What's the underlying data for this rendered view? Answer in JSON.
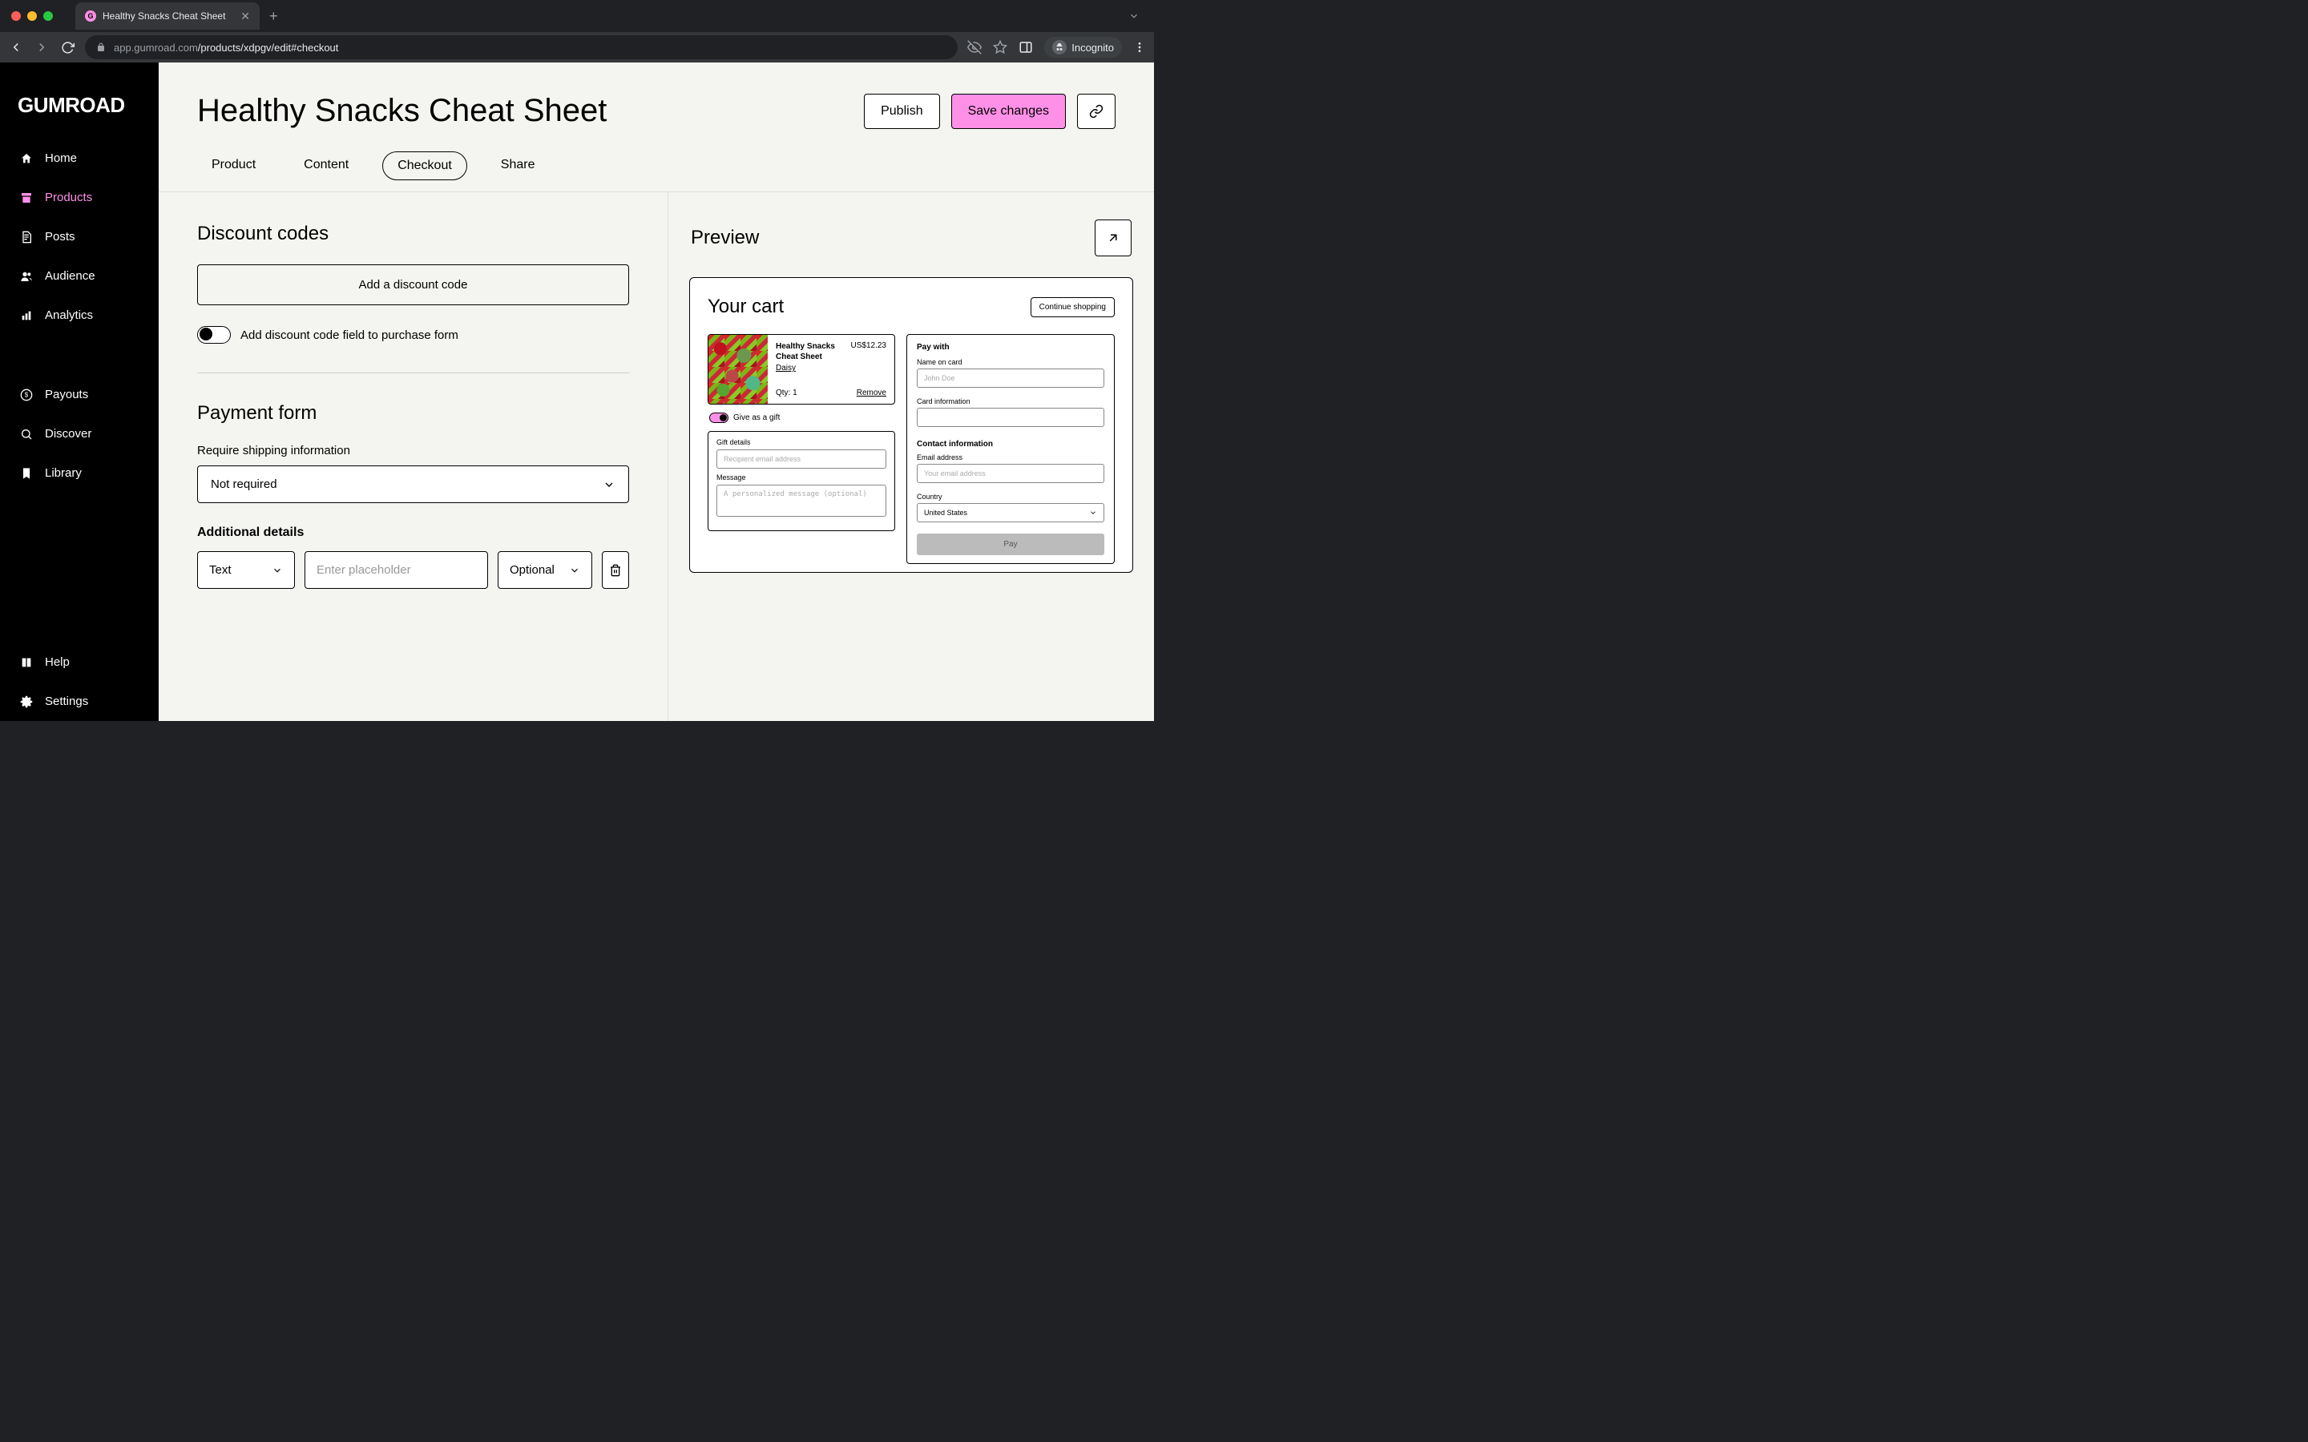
{
  "browser": {
    "tab_title": "Healthy Snacks Cheat Sheet",
    "url_host": "app.gumroad.com",
    "url_path": "/products/xdpgv/edit#checkout",
    "incognito_label": "Incognito"
  },
  "sidebar": {
    "logo": "GUMROAD",
    "items": [
      {
        "label": "Home",
        "icon": "home"
      },
      {
        "label": "Products",
        "icon": "archive",
        "active": true
      },
      {
        "label": "Posts",
        "icon": "file"
      },
      {
        "label": "Audience",
        "icon": "users"
      },
      {
        "label": "Analytics",
        "icon": "chart"
      }
    ],
    "lower_items": [
      {
        "label": "Payouts",
        "icon": "dollar"
      },
      {
        "label": "Discover",
        "icon": "search"
      },
      {
        "label": "Library",
        "icon": "bookmark"
      }
    ],
    "footer_items": [
      {
        "label": "Help",
        "icon": "book"
      },
      {
        "label": "Settings",
        "icon": "gear"
      }
    ]
  },
  "header": {
    "title": "Healthy Snacks Cheat Sheet",
    "publish": "Publish",
    "save": "Save changes"
  },
  "tabs": [
    "Product",
    "Content",
    "Checkout",
    "Share"
  ],
  "active_tab": "Checkout",
  "form": {
    "discount_title": "Discount codes",
    "add_discount": "Add a discount code",
    "discount_toggle_label": "Add discount code field to purchase form",
    "payment_title": "Payment form",
    "shipping_label": "Require shipping information",
    "shipping_value": "Not required",
    "additional_title": "Additional details",
    "type_value": "Text",
    "placeholder_placeholder": "Enter placeholder",
    "required_value": "Optional"
  },
  "preview": {
    "title": "Preview",
    "cart_title": "Your cart",
    "continue": "Continue shopping",
    "product_name": "Healthy Snacks Cheat Sheet",
    "price": "US$12.23",
    "author": "Daisy",
    "qty_label": "Qty: 1",
    "remove": "Remove",
    "gift_toggle": "Give as a gift",
    "gift_details": "Gift details",
    "recipient_placeholder": "Recipient email address",
    "message_label": "Message",
    "message_placeholder": "A personalized message (optional)",
    "pay_with": "Pay with",
    "name_label": "Name on card",
    "name_placeholder": "John Doe",
    "card_label": "Card information",
    "contact_title": "Contact information",
    "email_label": "Email address",
    "email_placeholder": "Your email address",
    "country_label": "Country",
    "country_value": "United States",
    "pay_button": "Pay"
  }
}
